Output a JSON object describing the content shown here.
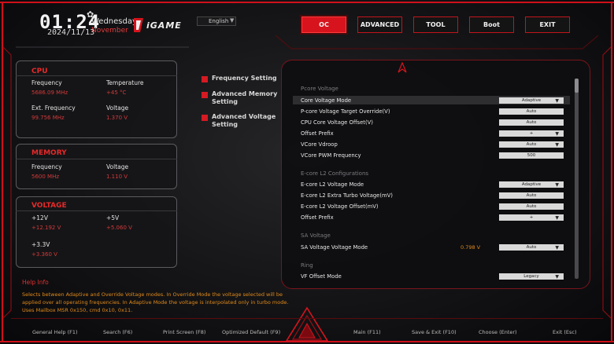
{
  "header": {
    "time": "01:24",
    "date": "2024/11/13",
    "weekday": "Wednesday",
    "month": "November",
    "brand": "iGAME",
    "language": "English",
    "accent_color": "#d7141d"
  },
  "tabs": [
    {
      "label": "OC",
      "active": true
    },
    {
      "label": "ADVANCED",
      "active": false
    },
    {
      "label": "TOOL",
      "active": false
    },
    {
      "label": "Boot",
      "active": false
    },
    {
      "label": "EXIT",
      "active": false
    }
  ],
  "cpu": {
    "title": "CPU",
    "frequency_label": "Frequency",
    "frequency_value": "5686.09 MHz",
    "temperature_label": "Temperature",
    "temperature_value": "+45 °C",
    "ext_frequency_label": "Ext. Frequency",
    "ext_frequency_value": "99.756 MHz",
    "voltage_label": "Voltage",
    "voltage_value": "1.370 V"
  },
  "memory": {
    "title": "MEMORY",
    "frequency_label": "Frequency",
    "frequency_value": "5600 MHz",
    "voltage_label": "Voltage",
    "voltage_value": "1.110 V"
  },
  "voltage": {
    "title": "VOLTAGE",
    "v12_label": "+12V",
    "v12_value": "+12.192 V",
    "v5_label": "+5V",
    "v5_value": "+5.060 V",
    "v33_label": "+3.3V",
    "v33_value": "+3.360 V"
  },
  "help": {
    "title": "Help Info",
    "text": "Selects between Adaptive and Override Voltage modes. In Override Mode the voltage selected will be applied over all operating frequencies. In Adaptive Mode the voltage is interpolated only in turbo mode. Uses Mailbox MSR 0x150, cmd 0x10, 0x11."
  },
  "menu": [
    {
      "label": "Frequency Setting"
    },
    {
      "label": "Advanced Memory Setting"
    },
    {
      "label": "Advanced Voltage Setting"
    }
  ],
  "settings": {
    "pcore_section": "Pcore Voltage",
    "ecore_section": "E-core L2 Configurations",
    "sa_section": "SA Voltage",
    "ring_section": "Ring",
    "rows": [
      {
        "label": "Core Voltage Mode",
        "value": "Adaptive",
        "caret": "▼"
      },
      {
        "label": "P-core Voltage Target Override(V)",
        "value": "Auto"
      },
      {
        "label": "CPU Core Voltage Offset(V)",
        "value": "Auto"
      },
      {
        "label": "Offset Prefix",
        "value": "+",
        "caret": "▼"
      },
      {
        "label": "VCore Vdroop",
        "value": "Auto",
        "caret": "▼"
      },
      {
        "label": "VCore PWM Frequency",
        "value": "500"
      },
      {
        "label": "E-core L2 Voltage Mode",
        "value": "Adaptive",
        "caret": "▼"
      },
      {
        "label": "E-core L2 Extra Turbo Voltage(mV)",
        "value": "Auto"
      },
      {
        "label": "E-core L2 Voltage Offset(mV)",
        "value": "Auto"
      },
      {
        "label": "Offset Prefix",
        "value": "+",
        "caret": "▼"
      },
      {
        "label": "SA Voltage Voltage Mode",
        "value": "Auto",
        "caret": "▼",
        "reading": "0.798 V"
      },
      {
        "label": "VF Offset Mode",
        "value": "Legacy",
        "caret": "▼"
      }
    ]
  },
  "footer": [
    {
      "label": "General Help (F1)"
    },
    {
      "label": "Search (F6)"
    },
    {
      "label": "Print Screen (F8)"
    },
    {
      "label": "Optimized Default (F9)"
    },
    {
      "label": "Main (F11)"
    },
    {
      "label": "Save & Exit (F10)"
    },
    {
      "label": "Choose (Enter)"
    },
    {
      "label": "Exit (Esc)"
    }
  ]
}
